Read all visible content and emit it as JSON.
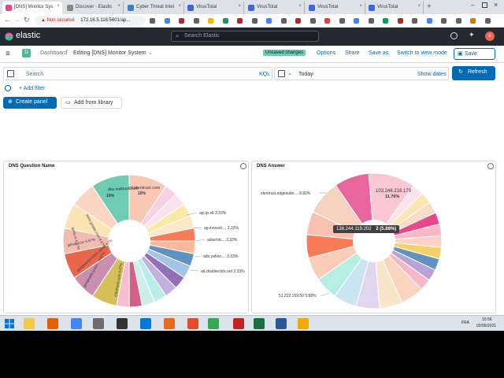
{
  "browser": {
    "tabs": [
      {
        "label": "[DNS] Monitor Sys",
        "active": true,
        "color": "#e8488b"
      },
      {
        "label": "Discover - Elastic",
        "active": false,
        "color": "#888888"
      },
      {
        "label": "Cyber Threat Intel",
        "active": false,
        "color": "#3c7ebf"
      },
      {
        "label": "VirusTotal",
        "active": false,
        "color": "#3c67d8"
      },
      {
        "label": "VirusTotal",
        "active": false,
        "color": "#3c67d8"
      },
      {
        "label": "VirusTotal",
        "active": false,
        "color": "#3c67d8"
      },
      {
        "label": "VirusTotal",
        "active": false,
        "color": "#3c67d8"
      }
    ],
    "security": "Non sécurisé",
    "url": "172.16.5.116:5601/ap..."
  },
  "header": {
    "brand": "elastic",
    "search_placeholder": "Search Elastic"
  },
  "toolbar": {
    "badge": "D",
    "breadcrumb_root": "Dashboard",
    "breadcrumb_current": "Editing [DNS] Monitor System",
    "unsaved": "Unsaved changes",
    "options": "Options",
    "share": "Share",
    "save_as": "Save as",
    "switch_view": "Switch to view mode",
    "save": "Save"
  },
  "query": {
    "search_placeholder": "Search",
    "kql": "KQL",
    "date": "Today",
    "show_dates": "Show dates",
    "refresh": "Refresh",
    "add_filter": "+ Add filter",
    "create_panel": "Create panel",
    "add_from_library": "Add from library"
  },
  "panels": {
    "question_title": "DNS Question Name",
    "answer_title": "DNS Answer"
  },
  "chart_data": [
    {
      "type": "pie",
      "title": "DNS Question Name",
      "donut": true,
      "slices": [
        {
          "label": "crl.identrust.com",
          "percent": "10%",
          "value": 10,
          "color": "#f8c8b4"
        },
        {
          "label": "",
          "value": 3.33,
          "color": "#f9d1e4"
        },
        {
          "label": "",
          "value": 3.33,
          "color": "#fbe3ee"
        },
        {
          "label": "api.ip.sb",
          "percent": "3.33%",
          "value": 3.33,
          "color": "#fbe9a6"
        },
        {
          "label": "",
          "value": 3.33,
          "color": "#fde8c7"
        },
        {
          "label": "ag.innovid....",
          "percent": "3.33%",
          "value": 3.33,
          "color": "#f87c5a"
        },
        {
          "label": "adservic...",
          "percent": "3.33%",
          "value": 3.33,
          "color": "#fbb89a"
        },
        {
          "label": "",
          "value": 3.33,
          "color": "#6092c0"
        },
        {
          "label": "ads.yahoo....",
          "percent": "3.33%",
          "value": 3.33,
          "color": "#a3c4e6"
        },
        {
          "label": "",
          "value": 3.33,
          "color": "#9170b8"
        },
        {
          "label": "ad.doubleclick.net",
          "percent": "3.33%",
          "value": 3.33,
          "color": "#c5b1e1"
        },
        {
          "label": "",
          "value": 3.33,
          "color": "#b9eee8"
        },
        {
          "label": "",
          "value": 3.33,
          "color": "#cdeee8"
        },
        {
          "label": "",
          "value": 3.33,
          "color": "#d36086"
        },
        {
          "label": "",
          "value": 3.33,
          "color": "#f6bed4"
        },
        {
          "label": "d.hubspot.com",
          "percent": "6.67%",
          "value": 6.67,
          "color": "#d6bf57"
        },
        {
          "label": "googleads.g.dou...",
          "percent": "6.67%",
          "value": 6.67,
          "color": "#ca8eae"
        },
        {
          "label": "googleadservices.com",
          "percent": "6.67%",
          "value": 6.67,
          "color": "#e7664c"
        },
        {
          "label": "github.com",
          "percent": "6.67%",
          "value": 6.67,
          "color": "#f2bdb0"
        },
        {
          "label": "ipinfo.io",
          "percent": "6.67%",
          "value": 6.67,
          "color": "#fbe3b4"
        },
        {
          "label": "fonts.gstatic.com",
          "percent": "6.67%",
          "value": 6.67,
          "color": "#fbd6c2"
        },
        {
          "label": "dns.msftncsi.com",
          "percent": "10%",
          "value": 10,
          "color": "#6dccb1"
        }
      ]
    },
    {
      "type": "pie",
      "title": "DNS Answer",
      "donut": true,
      "tooltip": {
        "label": "138.244.119.202",
        "value": "2 (5.88%)"
      },
      "slices": [
        {
          "label": "103.246.218.179",
          "percent": "11.76%",
          "value": 11.76,
          "color": "#fbc7d4"
        },
        {
          "label": "",
          "value": 2.94,
          "color": "#fde3ec"
        },
        {
          "label": "",
          "value": 2.94,
          "color": "#fbe6b4"
        },
        {
          "label": "",
          "value": 2.94,
          "color": "#fbdcc6"
        },
        {
          "label": "",
          "value": 2.94,
          "color": "#e8488b"
        },
        {
          "label": "",
          "value": 2.94,
          "color": "#f5b8c4"
        },
        {
          "label": "",
          "value": 2.94,
          "color": "#fcd2c4"
        },
        {
          "label": "",
          "value": 2.94,
          "color": "#f3d06b"
        },
        {
          "label": "",
          "value": 2.94,
          "color": "#6092c0"
        },
        {
          "label": "",
          "value": 2.94,
          "color": "#b7a3d8"
        },
        {
          "label": "",
          "value": 2.94,
          "color": "#f8b7c8"
        },
        {
          "label": "",
          "value": 5.88,
          "color": "#fbd2bb"
        },
        {
          "label": "",
          "value": 5.88,
          "color": "#f9e6c8"
        },
        {
          "label": "",
          "value": 5.88,
          "color": "#e0d6f0"
        },
        {
          "label": "51.222.159.50",
          "percent": "5.88%",
          "value": 5.88,
          "color": "#cbe4f4"
        },
        {
          "label": "",
          "value": 5.88,
          "color": "#b7eee4"
        },
        {
          "label": "",
          "value": 5.88,
          "color": "#fbcdb8"
        },
        {
          "label": "138.244.119.202",
          "percent": "5.88%",
          "value": 5.88,
          "color": "#f87c5a"
        },
        {
          "label": "",
          "value": 5.88,
          "color": "#f9c0b0"
        },
        {
          "label": "identrust.edgesuite....",
          "percent": "8.82%",
          "value": 8.82,
          "color": "#f8d2c0"
        },
        {
          "label": "",
          "value": 8.82,
          "color": "#e8669c"
        }
      ]
    }
  ],
  "taskbar": {
    "time": "10:56",
    "date": "02/05/2021",
    "lang": "FRA"
  }
}
